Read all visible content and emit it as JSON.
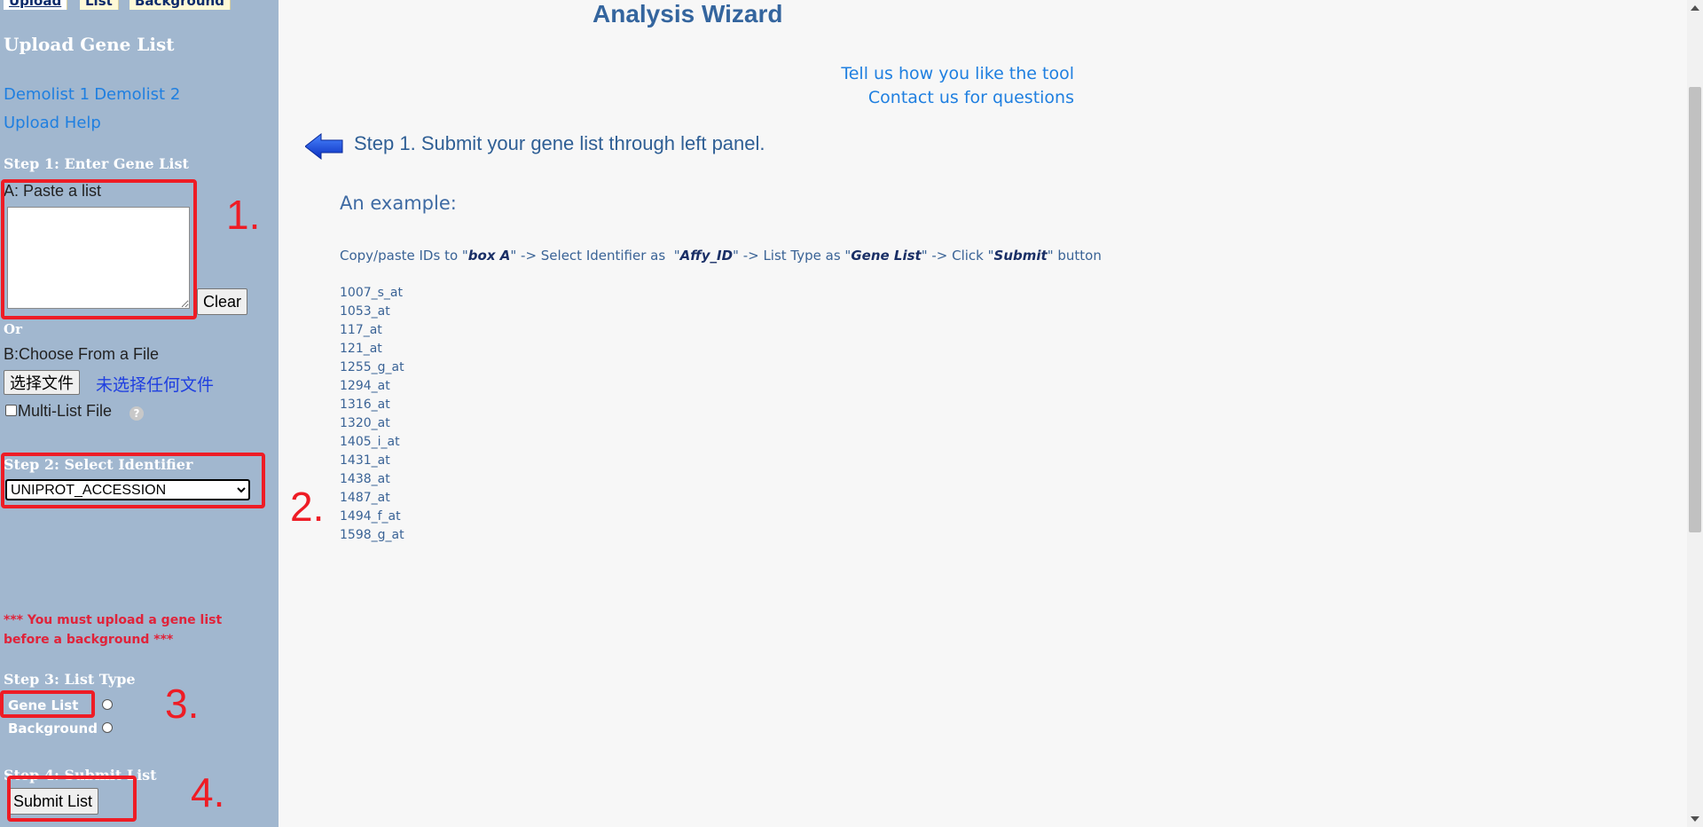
{
  "tabs": [
    "Upload",
    "List",
    "Background"
  ],
  "sidebar": {
    "title": "Upload Gene List",
    "demo1": "Demolist 1",
    "demo2": "Demolist 2",
    "help": "Upload Help",
    "step1": "Step 1: Enter Gene List",
    "paste_label": "A: Paste a list",
    "clear": "Clear",
    "or": "Or",
    "file_label": "B:Choose From a File",
    "choose_file": "选择文件",
    "no_file": "未选择任何文件",
    "multi": "Multi-List File",
    "step2": "Step 2: Select Identifier",
    "identifier": "UNIPROT_ACCESSION",
    "warning": "*** You must upload a gene list before a background ***",
    "step3": "Step 3: List Type",
    "gene_list": "Gene List",
    "background": "Background",
    "step4": "Step 4: Submit List",
    "submit": "Submit List"
  },
  "annotations": [
    "1.",
    "2.",
    "3.",
    "4."
  ],
  "main": {
    "title": "Analysis Wizard",
    "feedback": "Tell us how you like the tool",
    "contact": "Contact us for questions",
    "step1_text": "Step 1. Submit your gene list through left panel.",
    "example_title": "An example:",
    "instr": {
      "p1": "Copy/paste IDs to \"",
      "b1": "box A",
      "p2": "\" -> Select Identifier as  \"",
      "b2": "Affy_ID",
      "p3": "\" -> List Type as \"",
      "b3": "Gene List",
      "p4": "\" -> Click \"",
      "b4": "Submit",
      "p5": "\" button"
    },
    "ids": [
      "1007_s_at",
      "1053_at",
      "117_at",
      "121_at",
      "1255_g_at",
      "1294_at",
      "1316_at",
      "1320_at",
      "1405_i_at",
      "1431_at",
      "1438_at",
      "1487_at",
      "1494_f_at",
      "1598_g_at"
    ]
  },
  "colors": {
    "sidebar_bg": "#a1b7cf",
    "annotation_red": "#ee1c25",
    "link_blue": "#1f7fe0"
  }
}
